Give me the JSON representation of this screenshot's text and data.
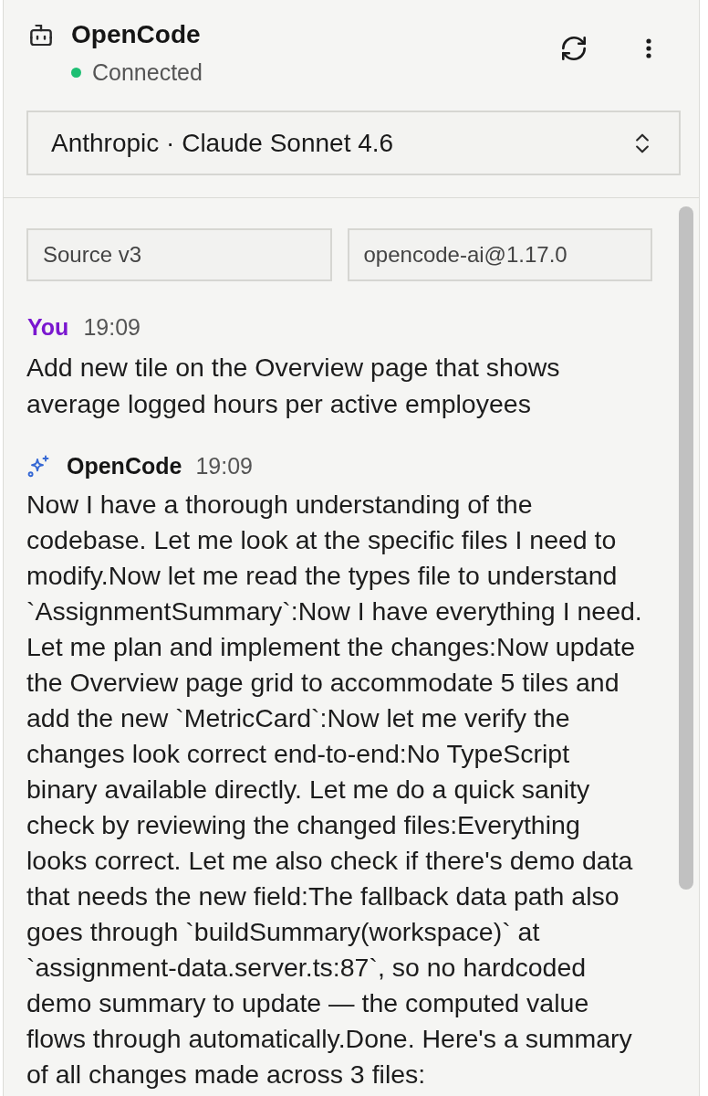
{
  "header": {
    "title": "OpenCode",
    "status": {
      "label": "Connected",
      "connected": true
    }
  },
  "model_select": {
    "value": "Anthropic · Claude Sonnet 4.6"
  },
  "context_fields": [
    {
      "value": "Source v3"
    },
    {
      "value": "opencode-ai@1.17.0"
    }
  ],
  "messages": [
    {
      "kind": "user",
      "author": "You",
      "time": "19:09",
      "text": "Add new tile on the Overview page that shows average logged hours per active employees"
    },
    {
      "kind": "assistant",
      "author": "OpenCode",
      "time": "19:09",
      "text": "Now I have a thorough understanding of the codebase. Let me look at the specific files I need to modify.Now let me read the types file to understand `AssignmentSummary`:Now I have everything I need. Let me plan and implement the changes:Now update the Overview page grid to accommodate 5 tiles and add the new `MetricCard`:Now let me verify the changes look correct end-to-end:No TypeScript binary available directly. Let me do a quick sanity check by reviewing the changed files:Everything looks correct. Let me also check if there's demo data that needs the new field:The fallback data path also goes through `buildSummary(workspace)` at `assignment-data.server.ts:87`, so no hardcoded demo summary to update — the computed value flows through automatically.Done. Here's a summary of all changes made across 3 files:"
    }
  ]
}
